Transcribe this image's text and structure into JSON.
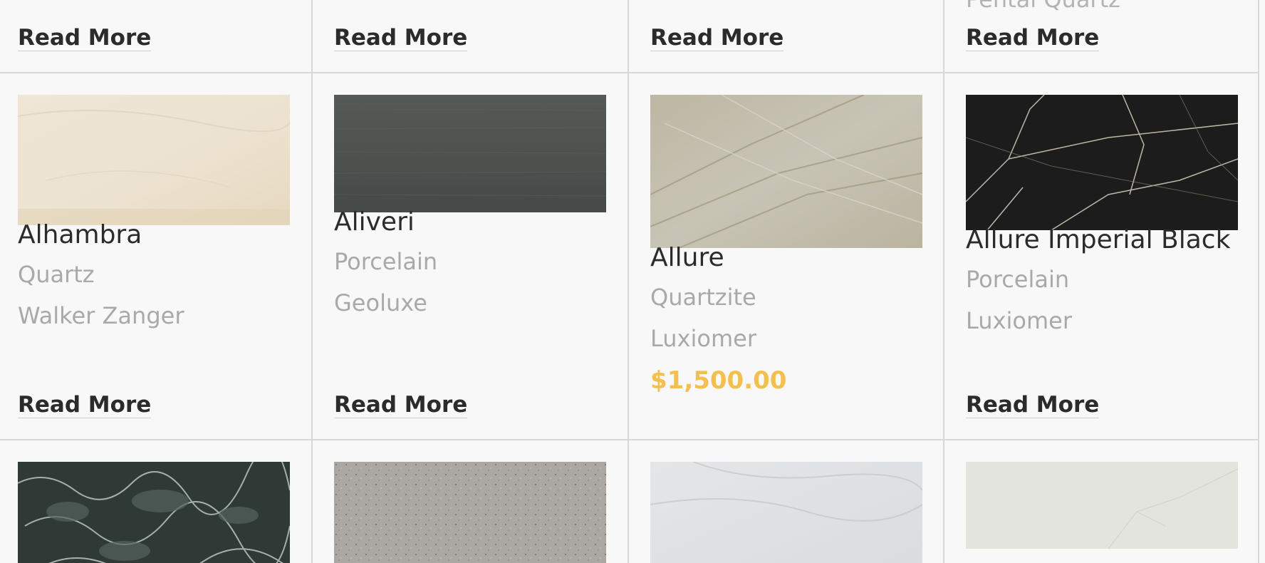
{
  "top_row": {
    "partial_text_col4": "Pental Quartz",
    "read_more_labels": [
      "Read More",
      "Read More",
      "Read More",
      "Read More"
    ]
  },
  "products": [
    {
      "name": "Alhambra",
      "material": "Quartz",
      "brand": "Walker Zanger",
      "read_more": "Read More"
    },
    {
      "name": "Aliveri",
      "material": "Porcelain",
      "brand": "Geoluxe",
      "read_more": "Read More"
    },
    {
      "name": "Allure",
      "material": "Quartzite",
      "brand": "Luxiomer",
      "price": "$1,500.00"
    },
    {
      "name": "Allure Imperial Black",
      "material": "Porcelain",
      "brand": "Luxiomer",
      "read_more": "Read More"
    }
  ],
  "colors": {
    "background": "#f8f8f8",
    "divider": "#d8d8d8",
    "title": "#2b2b2b",
    "meta": "#a9a9a9",
    "price": "#f3bf4f"
  }
}
